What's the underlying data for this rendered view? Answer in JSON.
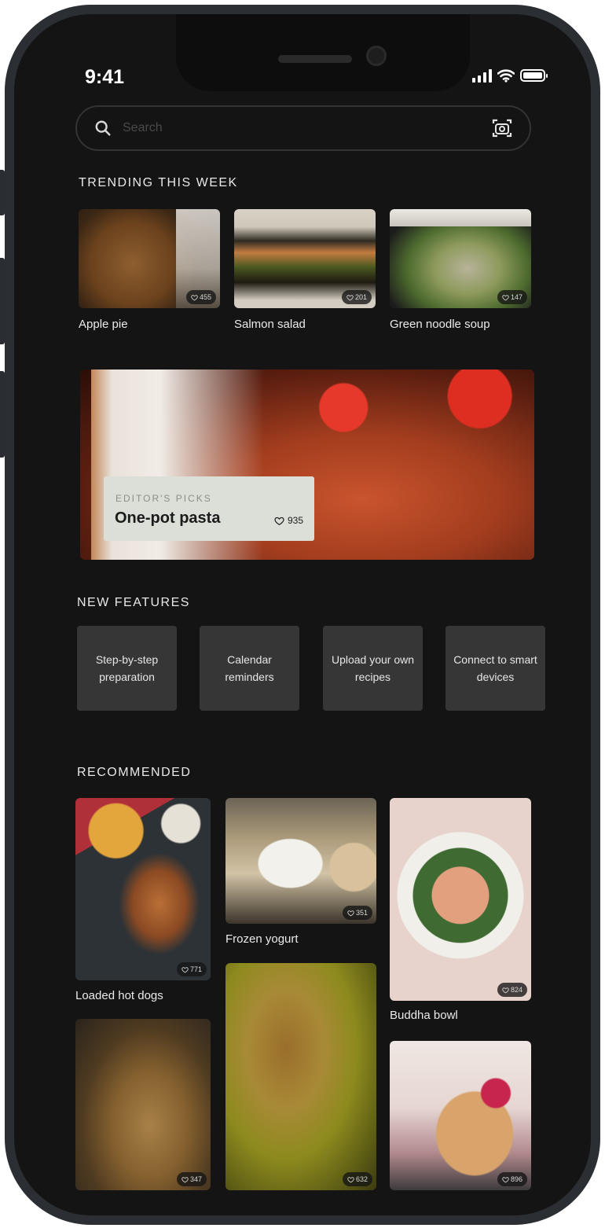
{
  "status_bar": {
    "time": "9:41"
  },
  "search": {
    "placeholder": "Search"
  },
  "sections": {
    "trending": "TRENDING THIS WEEK",
    "new_features": "NEW FEATURES",
    "recommended": "RECOMMENDED"
  },
  "trending": [
    {
      "label": "Apple pie",
      "likes": "455"
    },
    {
      "label": "Salmon salad",
      "likes": "201"
    },
    {
      "label": "Green noodle soup",
      "likes": "147"
    }
  ],
  "editors_pick": {
    "kicker": "EDITOR'S PICKS",
    "title": "One-pot pasta",
    "likes": "935"
  },
  "features": [
    "Step-by-step preparation",
    "Calendar reminders",
    "Upload your own recipes",
    "Connect to smart devices"
  ],
  "recommended": [
    {
      "label": "Loaded hot dogs",
      "likes": "771"
    },
    {
      "label": "Frozen yogurt",
      "likes": "351"
    },
    {
      "label": "Buddha bowl",
      "likes": "824"
    },
    {
      "label": "",
      "likes": "347"
    },
    {
      "label": "",
      "likes": "632"
    },
    {
      "label": "",
      "likes": "896"
    }
  ],
  "icons": [
    "search-icon",
    "camera-icon",
    "heart-icon",
    "wifi-icon",
    "signal-icon",
    "battery-icon"
  ],
  "colors": {
    "background": "#141414",
    "tile": "#363636",
    "editor_panel": "#dcdfd7",
    "frame": "#2b2e33"
  }
}
